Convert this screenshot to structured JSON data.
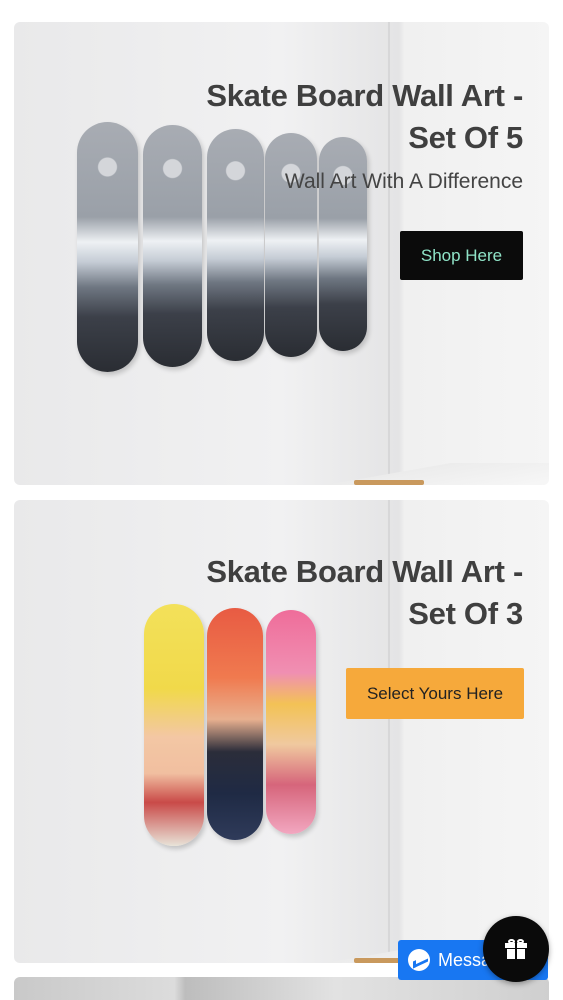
{
  "banners": [
    {
      "title": "Skate Board Wall Art -",
      "title_line2": "Set Of 5",
      "subtitle": "Wall Art With A Difference",
      "button_label": "Shop Here",
      "button_color": "#0b0b0b",
      "button_text_color": "#8fe3c7",
      "image": "mountain-skateboard-set-of-5"
    },
    {
      "title": "Skate Board Wall Art -",
      "title_line2": "Set Of 3",
      "button_label": "Select Yours Here",
      "button_color": "#f6a93b",
      "button_text_color": "#222222",
      "image": "pop-art-skateboard-set-of-3"
    }
  ],
  "messenger": {
    "label": "Messa",
    "icon": "messenger-icon",
    "color": "#1877f2"
  },
  "gift": {
    "icon": "gift-icon",
    "color": "#0a0a0a"
  }
}
